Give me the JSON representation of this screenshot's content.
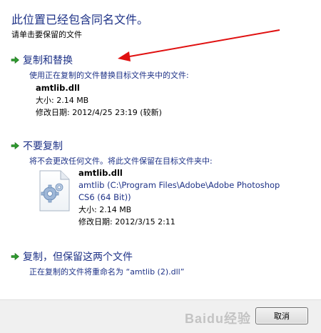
{
  "dialog": {
    "title": "此位置已经包含同名文件。",
    "subtitle": "请单击要保留的文件"
  },
  "options": [
    {
      "title": "复制和替换",
      "description": "使用正在复制的文件替换目标文件夹中的文件:",
      "file": {
        "name": "amtlib.dll",
        "size": "大小: 2.14 MB",
        "modified": "修改日期: 2012/4/25 23:19 (较新)"
      }
    },
    {
      "title": "不要复制",
      "description": "将不会更改任何文件。将此文件保留在目标文件夹中:",
      "file": {
        "name": "amtlib.dll",
        "path": "amtlib (C:\\Program Files\\Adobe\\Adobe Photoshop CS6 (64 Bit))",
        "size": "大小: 2.14 MB",
        "modified": "修改日期: 2012/3/15 2:11"
      }
    },
    {
      "title": "复制，但保留这两个文件",
      "description": "正在复制的文件将重命名为 “amtlib (2).dll”"
    }
  ],
  "footer": {
    "cancel_label": "取消",
    "watermark": "Baidu经验"
  },
  "colors": {
    "link_blue": "#1e3287",
    "arrow_green": "#2e9b2e",
    "annotation_red": "#e01010"
  }
}
